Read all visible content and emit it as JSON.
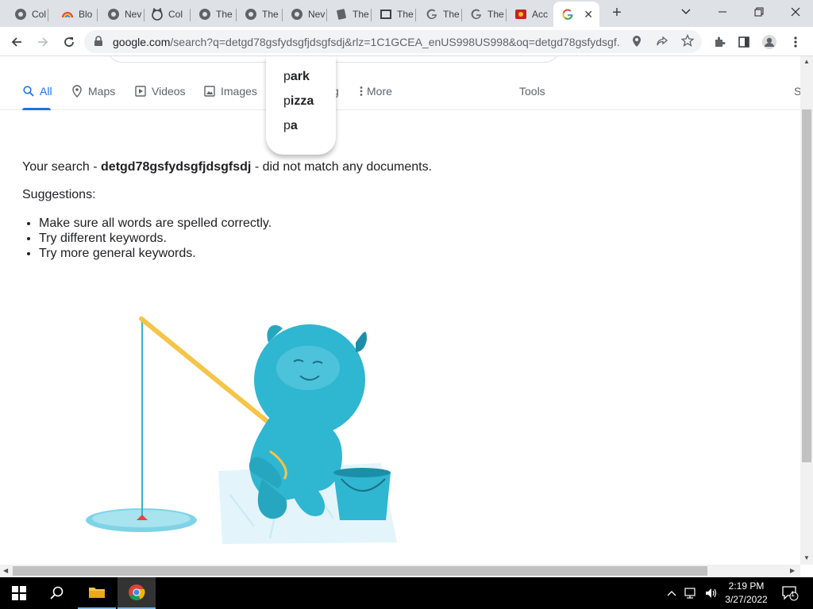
{
  "browser": {
    "tabs": [
      {
        "label": "Col",
        "icon": "globe-icon"
      },
      {
        "label": "Blo",
        "icon": "rainbow-icon"
      },
      {
        "label": "Nev",
        "icon": "globe-icon"
      },
      {
        "label": "Col",
        "icon": "cat-icon"
      },
      {
        "label": "The",
        "icon": "globe-icon"
      },
      {
        "label": "The",
        "icon": "globe-icon"
      },
      {
        "label": "Nev",
        "icon": "globe-icon"
      },
      {
        "label": "The",
        "icon": "page-icon"
      },
      {
        "label": "The",
        "icon": "film-icon"
      },
      {
        "label": "The",
        "icon": "google-icon"
      },
      {
        "label": "The",
        "icon": "google-icon"
      },
      {
        "label": "Acc",
        "icon": "photo-icon"
      }
    ],
    "active_tab_icon": "google-icon",
    "new_tab_label": "+",
    "url_host": "google.com",
    "url_rest": "/search?q=detgd78gsfydsgfjdsgfsdj&rlz=1C1GCEA_enUS998US998&oq=detgd78gsfydsgf..."
  },
  "search_tabs": {
    "all": "All",
    "maps": "Maps",
    "videos": "Videos",
    "images": "Images",
    "shopping_fragment": "g",
    "more": "More",
    "tools": "Tools",
    "edge_fragment": "S"
  },
  "autocomplete": [
    {
      "typed": "p",
      "completion": "ark"
    },
    {
      "typed": "p",
      "completion": "izza"
    },
    {
      "typed": "p",
      "completion": "a"
    }
  ],
  "results": {
    "prefix": "Your search - ",
    "query": "detgd78gsfydsgfjdsgfsdj",
    "suffix": " - did not match any documents.",
    "suggestions_label": "Suggestions:",
    "tips": [
      "Make sure all words are spelled correctly.",
      "Try different keywords.",
      "Try more general keywords."
    ]
  },
  "taskbar": {
    "time": "2:19 PM",
    "date": "3/27/2022",
    "notification_count": "1"
  },
  "colors": {
    "accent": "#1a73e8",
    "yeti": "#2fb6d1",
    "rod": "#f6c447"
  }
}
